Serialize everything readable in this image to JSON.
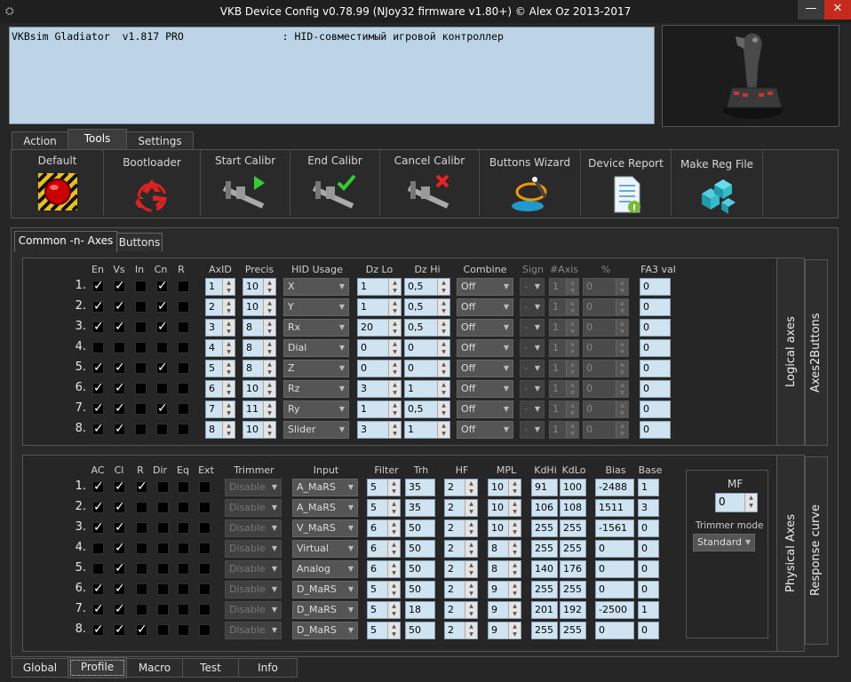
{
  "window": {
    "title": "VKB Device Config v0.78.99 (NJoy32 firmware v1.80+) © Alex Oz 2013-2017",
    "min": "—",
    "close": "✕"
  },
  "info": {
    "text": "VKBsim Gladiator  v1.817 PRO                : HID-совместимый игровой контроллер"
  },
  "tabs": [
    "Action",
    "Tools",
    "Settings"
  ],
  "tools": [
    "Default",
    "Bootloader",
    "Start Calibr",
    "End Calibr",
    "Cancel Calibr",
    "Buttons Wizard",
    "Device Report",
    "Make Reg File"
  ],
  "subtabs": [
    "Common -n- Axes",
    "Buttons"
  ],
  "logical": {
    "side1": "Logical axes",
    "side2": "Axes2Buttons",
    "headers": {
      "en": "En",
      "vs": "Vs",
      "in": "In",
      "cn": "Cn",
      "r": "R",
      "axid": "AxID",
      "precis": "Precis",
      "hid": "HID Usage",
      "dzlo": "Dz Lo",
      "dzhi": "Dz Hi",
      "combine": "Combine",
      "sign": "Sign",
      "naxis": "#Axis",
      "pct": "%",
      "fa3": "FA3 val"
    },
    "rows": [
      {
        "n": "1.",
        "en": 1,
        "vs": 1,
        "in": 0,
        "cn": 1,
        "r": 0,
        "axid": "1",
        "precis": "10",
        "hid": "X",
        "dzlo": "1",
        "dzhi": "0,5",
        "combine": "Off",
        "sign": "-",
        "naxis": "1",
        "pct": "0",
        "fa3": "0"
      },
      {
        "n": "2.",
        "en": 1,
        "vs": 1,
        "in": 0,
        "cn": 1,
        "r": 0,
        "axid": "2",
        "precis": "10",
        "hid": "Y",
        "dzlo": "1",
        "dzhi": "0,5",
        "combine": "Off",
        "sign": "-",
        "naxis": "1",
        "pct": "0",
        "fa3": "0"
      },
      {
        "n": "3.",
        "en": 1,
        "vs": 1,
        "in": 0,
        "cn": 1,
        "r": 0,
        "axid": "3",
        "precis": "8",
        "hid": "Rx",
        "dzlo": "20",
        "dzhi": "0,5",
        "combine": "Off",
        "sign": "-",
        "naxis": "1",
        "pct": "0",
        "fa3": "0"
      },
      {
        "n": "4.",
        "en": 0,
        "vs": 0,
        "in": 0,
        "cn": 0,
        "r": 0,
        "axid": "4",
        "precis": "8",
        "hid": "Dial",
        "dzlo": "0",
        "dzhi": "0",
        "combine": "Off",
        "sign": "-",
        "naxis": "1",
        "pct": "0",
        "fa3": "0"
      },
      {
        "n": "5.",
        "en": 1,
        "vs": 1,
        "in": 0,
        "cn": 1,
        "r": 0,
        "axid": "5",
        "precis": "8",
        "hid": "Z",
        "dzlo": "0",
        "dzhi": "0",
        "combine": "Off",
        "sign": "-",
        "naxis": "1",
        "pct": "0",
        "fa3": "0"
      },
      {
        "n": "6.",
        "en": 1,
        "vs": 1,
        "in": 0,
        "cn": 0,
        "r": 0,
        "axid": "6",
        "precis": "10",
        "hid": "Rz",
        "dzlo": "3",
        "dzhi": "1",
        "combine": "Off",
        "sign": "-",
        "naxis": "1",
        "pct": "0",
        "fa3": "0"
      },
      {
        "n": "7.",
        "en": 1,
        "vs": 1,
        "in": 0,
        "cn": 1,
        "r": 0,
        "axid": "7",
        "precis": "11",
        "hid": "Ry",
        "dzlo": "1",
        "dzhi": "0,5",
        "combine": "Off",
        "sign": "-",
        "naxis": "1",
        "pct": "0",
        "fa3": "0"
      },
      {
        "n": "8.",
        "en": 1,
        "vs": 1,
        "in": 0,
        "cn": 0,
        "r": 0,
        "axid": "8",
        "precis": "10",
        "hid": "Slider",
        "dzlo": "3",
        "dzhi": "1",
        "combine": "Off",
        "sign": "-",
        "naxis": "1",
        "pct": "0",
        "fa3": "0"
      }
    ]
  },
  "physical": {
    "side1": "Physical Axes",
    "side2": "Response curve",
    "headers": {
      "ac": "AC",
      "cl": "Cl",
      "r": "R",
      "dir": "Dir",
      "eq": "Eq",
      "ext": "Ext",
      "trimmer": "Trimmer",
      "input": "Input",
      "filter": "Filter",
      "trh": "Trh",
      "hf": "HF",
      "mpl": "MPL",
      "kdhi": "KdHi",
      "kdlo": "KdLo",
      "bias": "Bias",
      "base": "Base"
    },
    "rows": [
      {
        "n": "1.",
        "ac": 1,
        "cl": 1,
        "r": 1,
        "dir": 0,
        "eq": 0,
        "ext": 0,
        "trimmer": "Disable",
        "input": "A_MaRS",
        "filter": "5",
        "trh": "35",
        "hf": "2",
        "mpl": "10",
        "kdhi": "91",
        "kdlo": "100",
        "bias": "-2488",
        "base": "1"
      },
      {
        "n": "2.",
        "ac": 1,
        "cl": 1,
        "r": 0,
        "dir": 0,
        "eq": 0,
        "ext": 0,
        "trimmer": "Disable",
        "input": "A_MaRS",
        "filter": "5",
        "trh": "35",
        "hf": "2",
        "mpl": "10",
        "kdhi": "106",
        "kdlo": "108",
        "bias": "1511",
        "base": "3"
      },
      {
        "n": "3.",
        "ac": 1,
        "cl": 1,
        "r": 0,
        "dir": 0,
        "eq": 0,
        "ext": 0,
        "trimmer": "Disable",
        "input": "V_MaRS",
        "filter": "6",
        "trh": "50",
        "hf": "2",
        "mpl": "10",
        "kdhi": "255",
        "kdlo": "255",
        "bias": "-1561",
        "base": "0"
      },
      {
        "n": "4.",
        "ac": 0,
        "cl": 1,
        "r": 0,
        "dir": 0,
        "eq": 0,
        "ext": 0,
        "trimmer": "Disable",
        "input": "Virtual",
        "filter": "6",
        "trh": "50",
        "hf": "2",
        "mpl": "8",
        "kdhi": "255",
        "kdlo": "255",
        "bias": "0",
        "base": "0"
      },
      {
        "n": "5.",
        "ac": 0,
        "cl": 1,
        "r": 0,
        "dir": 0,
        "eq": 0,
        "ext": 0,
        "trimmer": "Disable",
        "input": "Analog",
        "filter": "6",
        "trh": "50",
        "hf": "2",
        "mpl": "8",
        "kdhi": "140",
        "kdlo": "176",
        "bias": "0",
        "base": "0"
      },
      {
        "n": "6.",
        "ac": 1,
        "cl": 1,
        "r": 0,
        "dir": 0,
        "eq": 0,
        "ext": 0,
        "trimmer": "Disable",
        "input": "D_MaRS",
        "filter": "5",
        "trh": "50",
        "hf": "2",
        "mpl": "9",
        "kdhi": "255",
        "kdlo": "255",
        "bias": "0",
        "base": "0"
      },
      {
        "n": "7.",
        "ac": 1,
        "cl": 1,
        "r": 0,
        "dir": 0,
        "eq": 0,
        "ext": 0,
        "trimmer": "Disable",
        "input": "D_MaRS",
        "filter": "5",
        "trh": "18",
        "hf": "2",
        "mpl": "9",
        "kdhi": "201",
        "kdlo": "192",
        "bias": "-2500",
        "base": "1"
      },
      {
        "n": "8.",
        "ac": 1,
        "cl": 1,
        "r": 1,
        "dir": 0,
        "eq": 0,
        "ext": 0,
        "trimmer": "Disable",
        "input": "D_MaRS",
        "filter": "5",
        "trh": "50",
        "hf": "2",
        "mpl": "9",
        "kdhi": "255",
        "kdlo": "255",
        "bias": "0",
        "base": "0"
      }
    ]
  },
  "mf": {
    "label": "MF",
    "value": "0",
    "trimmer_mode_label": "Trimmer mode",
    "trimmer_mode": "Standard"
  },
  "bottom_tabs": [
    "Global",
    "Profile",
    "Macro",
    "Test",
    "Info"
  ],
  "colors": {
    "field_bg": "#cfe3f1",
    "info_bg": "#bcd4e6",
    "close_red": "#c42b1c",
    "bg": "#262626"
  }
}
